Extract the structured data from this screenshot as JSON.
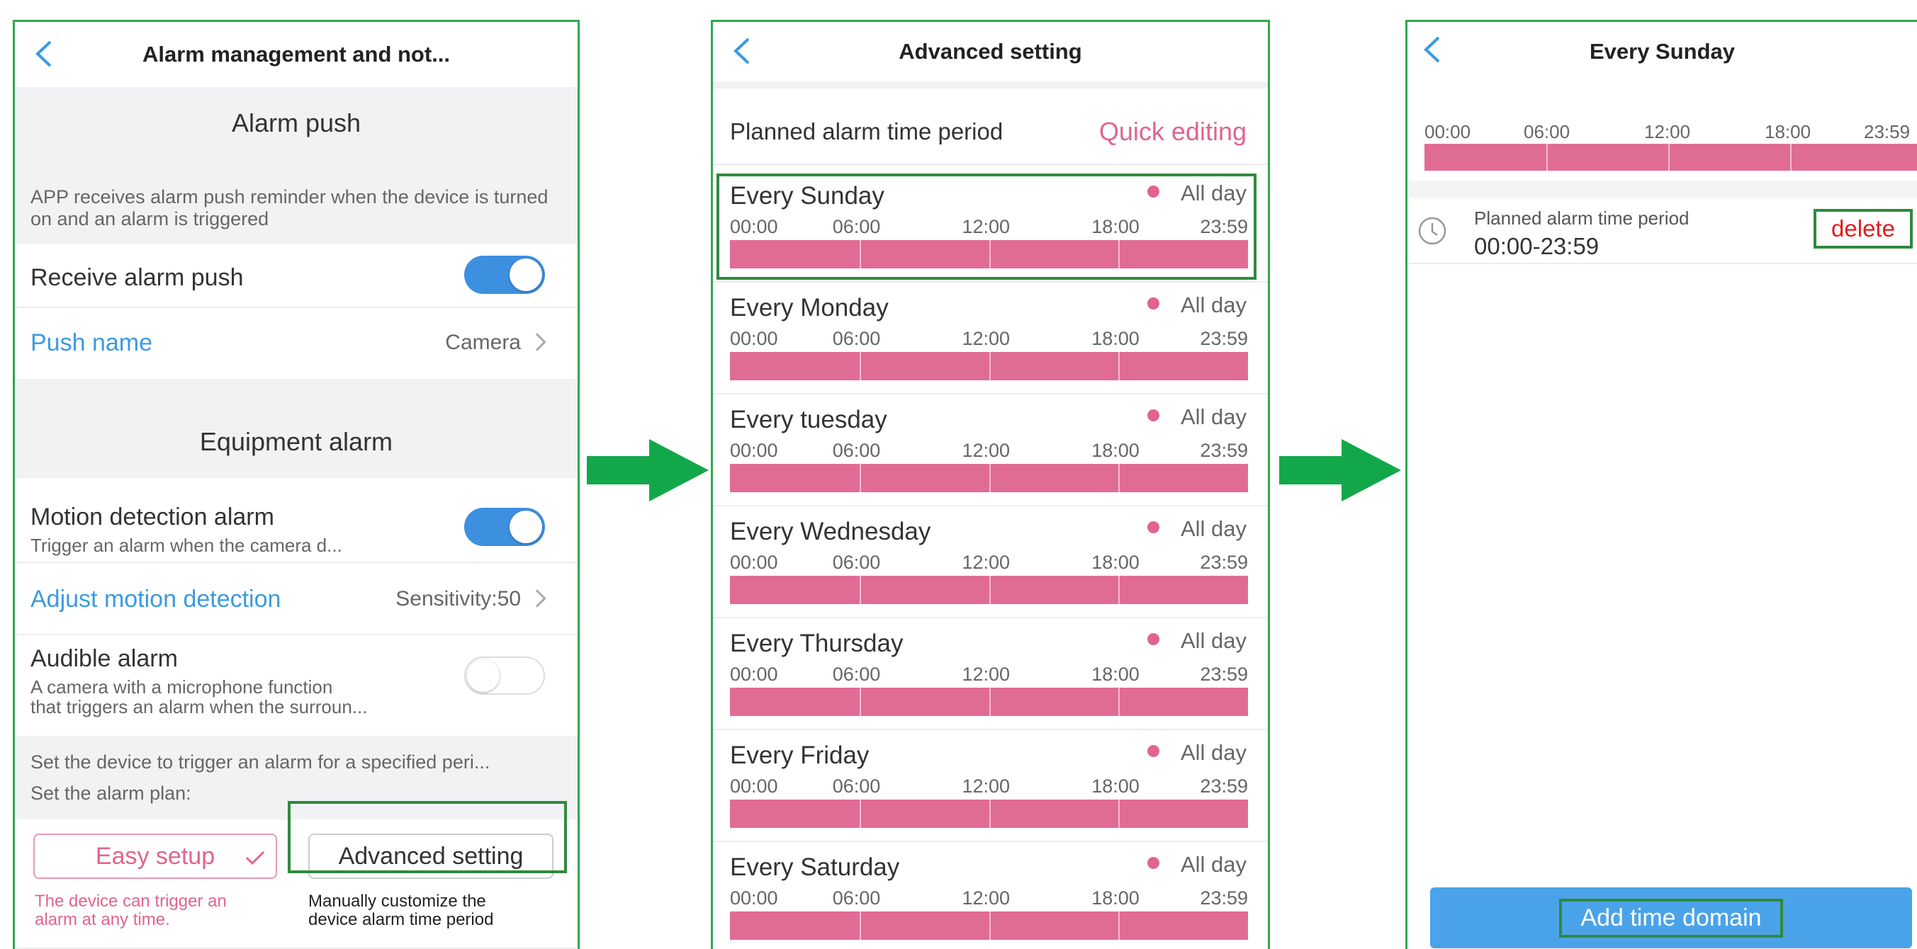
{
  "panel1": {
    "title": "Alarm management and not...",
    "alarm_push": {
      "header": "Alarm push",
      "description": "APP receives alarm push reminder when the device is turned on and an alarm is triggered",
      "receive_label": "Receive alarm push",
      "receive_on": true,
      "push_name_label": "Push name",
      "push_name_value": "Camera"
    },
    "equipment_alarm": {
      "header": "Equipment alarm",
      "motion_label": "Motion detection alarm",
      "motion_desc": "Trigger an alarm when the camera d...",
      "motion_on": true,
      "adjust_label": "Adjust motion detection",
      "sensitivity": "Sensitivity:50",
      "audible_label": "Audible alarm",
      "audible_desc_1": "A camera with a microphone function",
      "audible_desc_2": "that triggers an alarm when the surroun...",
      "audible_on": false
    },
    "plan": {
      "line1": "Set the device to trigger an alarm for a specified peri...",
      "line2": "Set the alarm plan:",
      "easy_label": "Easy setup",
      "easy_caption_1": "The device can trigger an",
      "easy_caption_2": "alarm at any time.",
      "advanced_label": "Advanced setting",
      "advanced_caption_1": "Manually customize the",
      "advanced_caption_2": "device alarm time period"
    }
  },
  "panel2": {
    "title": "Advanced setting",
    "period_label": "Planned alarm time period",
    "quick_editing": "Quick editing",
    "all_day": "All day",
    "ticks": [
      "00:00",
      "06:00",
      "12:00",
      "18:00",
      "23:59"
    ],
    "days": [
      "Every Sunday",
      "Every Monday",
      "Every tuesday",
      "Every Wednesday",
      "Every Thursday",
      "Every Friday",
      "Every Saturday"
    ]
  },
  "panel3": {
    "title": "Every Sunday",
    "ticks": [
      "00:00",
      "06:00",
      "12:00",
      "18:00",
      "23:59"
    ],
    "period_label": "Planned alarm time period",
    "period_value": "00:00-23:59",
    "delete_label": "delete",
    "add_button": "Add time domain"
  },
  "colors": {
    "accent_blue": "#3a9be0",
    "accent_pink": "#e0648f",
    "highlight_green": "#2f8a3d",
    "arrow_green": "#12a84a"
  }
}
